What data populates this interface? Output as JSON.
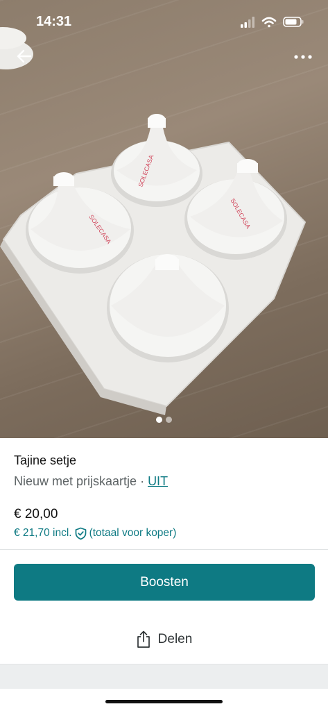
{
  "status_bar": {
    "time": "14:31"
  },
  "photo": {
    "brand_text": "SOLECASA",
    "slide_count": 2,
    "active_slide": 1
  },
  "product": {
    "title": "Tajine setje",
    "condition": "Nieuw met prijskaartje",
    "separator": " · ",
    "brand_link": "UIT",
    "price": "€ 20,00",
    "price_incl": "€ 21,70 incl.",
    "price_incl_note": "(totaal voor koper)"
  },
  "actions": {
    "boost_label": "Boosten",
    "share_label": "Delen"
  },
  "colors": {
    "accent": "#0e7a83",
    "text": "#111111",
    "muted": "#5e6466"
  },
  "icons": [
    "back-arrow-icon",
    "more-icon",
    "shield-check-icon",
    "share-icon",
    "signal-icon",
    "wifi-icon",
    "battery-icon"
  ]
}
